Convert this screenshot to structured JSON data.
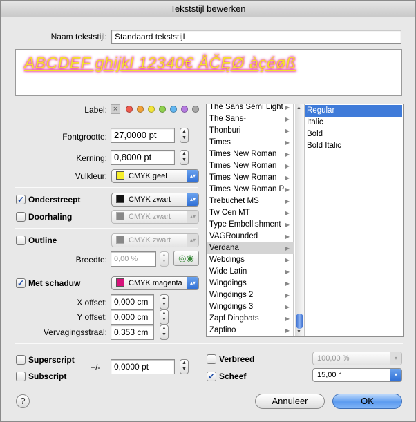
{
  "window": {
    "title": "Tekststijl bewerken"
  },
  "name_label": "Naam tekststijl:",
  "name_value": "Standaard tekststijl",
  "preview_text": "ABCDEF ghijkl 12340€ ÅČĘØ àçéøß",
  "label_label": "Label:",
  "label_colors": [
    "#e8e8e8",
    "#ee5a4e",
    "#f2a33a",
    "#f2e53a",
    "#8fd14f",
    "#62b6f0",
    "#b57be0",
    "#a8a8a8"
  ],
  "fontsize": {
    "label": "Fontgrootte:",
    "value": "27,0000 pt"
  },
  "kerning": {
    "label": "Kerning:",
    "value": "0,8000 pt"
  },
  "fill": {
    "label": "Vulkleur:",
    "value": "CMYK geel",
    "color": "#f7ef2b"
  },
  "underline": {
    "label": "Onderstreept",
    "checked": true,
    "value": "CMYK zwart",
    "color": "#111111"
  },
  "strike": {
    "label": "Doorhaling",
    "checked": false,
    "value": "CMYK zwart",
    "color": "#888888"
  },
  "outline": {
    "label": "Outline",
    "checked": false,
    "value": "CMYK zwart",
    "color": "#888888"
  },
  "width": {
    "label": "Breedte:",
    "value": "0,00 %"
  },
  "shadow": {
    "label": "Met schaduw",
    "checked": true,
    "value": "CMYK magenta",
    "color": "#d6127a"
  },
  "xoffset": {
    "label": "X offset:",
    "value": "0,000 cm"
  },
  "yoffset": {
    "label": "Y offset:",
    "value": "0,000 cm"
  },
  "blur": {
    "label": "Vervagingsstraal:",
    "value": "0,353 cm"
  },
  "fonts": [
    "The Sans Semi Light",
    "The Sans-",
    "Thonburi",
    "Times",
    "Times New Roman",
    "Times New Roman",
    "Times New Roman",
    "Times New Roman P",
    "Trebuchet MS",
    "Tw Cen MT",
    "Type Embellishment",
    "VAGRounded",
    "Verdana",
    "Webdings",
    "Wide Latin",
    "Wingdings",
    "Wingdings 2",
    "Wingdings 3",
    "Zapf Dingbats",
    "Zapfino"
  ],
  "selected_font": "Verdana",
  "styles": [
    "Regular",
    "Italic",
    "Bold",
    "Bold Italic"
  ],
  "selected_style": "Regular",
  "superscript": {
    "label": "Superscript",
    "checked": false
  },
  "subscript": {
    "label": "Subscript",
    "checked": false
  },
  "plusminus": {
    "label": "+/-",
    "value": "0,0000 pt"
  },
  "widen": {
    "label": "Verbreed",
    "checked": false,
    "value": "100,00 %"
  },
  "italicize": {
    "label": "Scheef",
    "checked": true,
    "value": "15,00 °"
  },
  "buttons": {
    "help": "?",
    "cancel": "Annuleer",
    "ok": "OK"
  }
}
